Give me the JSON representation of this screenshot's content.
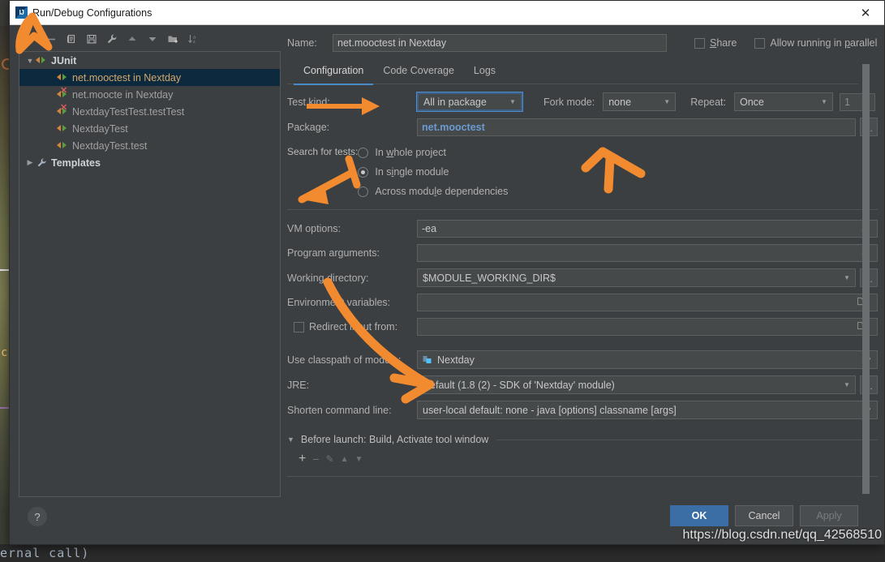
{
  "window": {
    "title": "Run/Debug Configurations",
    "logo_text": "IJ",
    "close_icon": "✕"
  },
  "tree_toolbar": {
    "buttons": [
      {
        "name": "add-configuration-button",
        "glyph": "+"
      },
      {
        "name": "remove-configuration-button",
        "glyph": "−"
      },
      {
        "name": "copy-configuration-button",
        "glyph": "⧉"
      },
      {
        "name": "save-configuration-button",
        "glyph": "💾"
      },
      {
        "name": "edit-templates-button",
        "glyph": "🔧"
      },
      {
        "name": "move-up-button",
        "glyph": "▲"
      },
      {
        "name": "move-down-button",
        "glyph": "▼"
      },
      {
        "name": "new-folder-button",
        "glyph": "🗀"
      },
      {
        "name": "sort-configurations-button",
        "glyph": "↓ᴀᴢ"
      }
    ]
  },
  "tree": {
    "groups": [
      {
        "label": "JUnit",
        "twisty": "▼",
        "icon": "junit-icon"
      },
      {
        "label": "Templates",
        "twisty": "▶",
        "icon": "wrench-icon"
      }
    ],
    "items": [
      {
        "label": "net.mooctest in Nextday",
        "selected": true,
        "error": false
      },
      {
        "label": "net.moocte in Nextday",
        "selected": false,
        "error": true
      },
      {
        "label": "NextdayTestTest.testTest",
        "selected": false,
        "error": true
      },
      {
        "label": "NextdayTest",
        "selected": false,
        "error": false
      },
      {
        "label": "NextdayTest.test",
        "selected": false,
        "error": false
      }
    ]
  },
  "name_row": {
    "label": "Name:",
    "value": "net.mooctest in Nextday",
    "placeholder": "Name",
    "share_label_pre": "",
    "share_label_mnemonic": "S",
    "share_label_post": "hare",
    "parallel_pre": "Allow running in ",
    "parallel_mnemonic": "p",
    "parallel_post": "arallel",
    "share_checked": false,
    "parallel_checked": false
  },
  "tabs": [
    {
      "label": "Configuration",
      "active": true
    },
    {
      "label": "Code Coverage",
      "active": false
    },
    {
      "label": "Logs",
      "active": false
    }
  ],
  "config": {
    "test_kind": {
      "label_pre": "Test ",
      "label_mnemonic": "k",
      "label_post": "ind:",
      "label": "Test kind:",
      "value": "All in package",
      "focused": true
    },
    "fork_mode": {
      "label": "Fork mode:",
      "value": "none"
    },
    "repeat": {
      "label": "Repeat:",
      "value": "Once",
      "count": "1"
    },
    "package": {
      "label": "Package:",
      "value": "net.mooctest",
      "browse_glyph": "..."
    },
    "search_for_tests": {
      "label": "Search for tests:",
      "options": [
        {
          "pre": "In ",
          "mnemonic": "w",
          "post": "hole project",
          "label": "In whole project",
          "selected": false
        },
        {
          "pre": "In s",
          "mnemonic": "i",
          "post": "ngle module",
          "label": "In single module",
          "selected": true
        },
        {
          "pre": "Across modu",
          "mnemonic": "l",
          "post": "e dependencies",
          "label": "Across module dependencies",
          "selected": false
        }
      ]
    },
    "vm_options": {
      "label": "VM options:",
      "value": "-ea",
      "expand_glyph": "⤢"
    },
    "program_arguments": {
      "label": "Program arguments:",
      "value": "",
      "expand_glyph": "⤢"
    },
    "working_directory": {
      "label": "Working directory:",
      "value": "$MODULE_WORKING_DIR$",
      "browse_glyph": "..."
    },
    "environment_variables": {
      "label": "Environment variables:",
      "value": "",
      "folder_glyph": "🗀"
    },
    "redirect_input": {
      "label": "Redirect input from:",
      "value": "",
      "checked": false,
      "folder_glyph": "🗀"
    },
    "use_classpath": {
      "label": "Use classpath of module:",
      "value": "Nextday"
    },
    "jre": {
      "label": "JRE:",
      "value": "Default (1.8 (2) - SDK of 'Nextday' module)",
      "browse_glyph": "..."
    },
    "shorten_command_line": {
      "label": "Shorten command line:",
      "value": "user-local default: none - java [options] classname [args]"
    }
  },
  "before_launch": {
    "twisty": "▼",
    "label": "Before launch: Build, Activate tool window",
    "toolbar": [
      {
        "name": "before-launch-add-button",
        "glyph": "+"
      },
      {
        "name": "before-launch-remove-button",
        "glyph": "−"
      },
      {
        "name": "before-launch-edit-button",
        "glyph": "✎"
      },
      {
        "name": "before-launch-move-up-button",
        "glyph": "▲"
      },
      {
        "name": "before-launch-move-down-button",
        "glyph": "▼"
      }
    ]
  },
  "footer": {
    "help_glyph": "?",
    "ok": "OK",
    "cancel": "Cancel",
    "apply": "Apply"
  },
  "watermark": "https://blog.csdn.net/qq_42568510",
  "backdrop": {
    "editor_text": "ernal call)"
  },
  "colors": {
    "accent_blue": "#3b6ea5",
    "tab_underline": "#4a88c7",
    "selection": "#0d293e",
    "annotation_orange": "#f28b30",
    "package_value": "#6b9bd2",
    "dialog_bg": "#3c3f41",
    "field_bg": "#45494a"
  }
}
